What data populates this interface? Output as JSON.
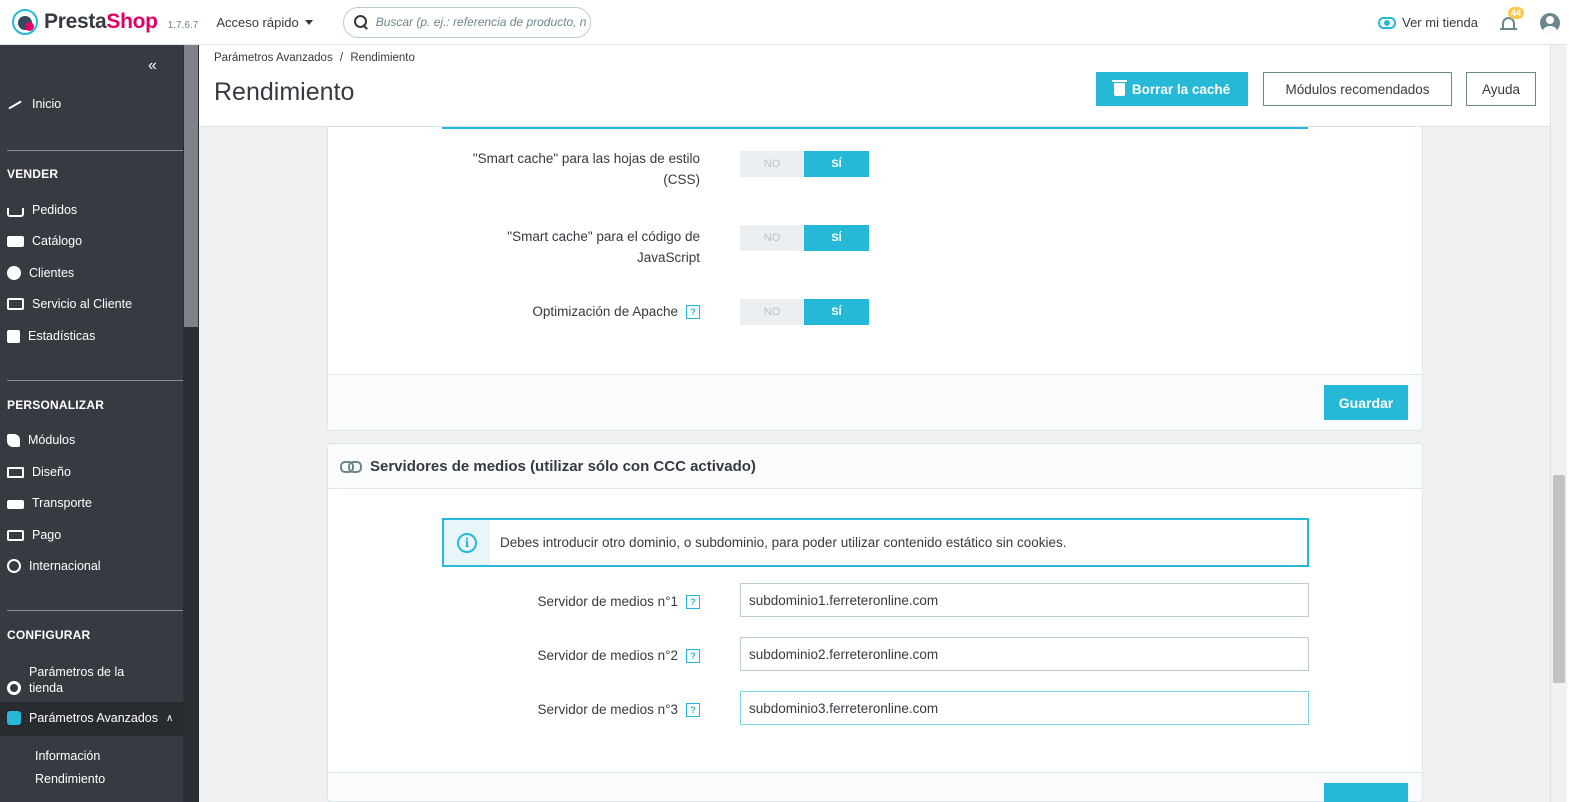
{
  "header": {
    "brand_presta": "Presta",
    "brand_shop": "Shop",
    "version": "1.7.6.7",
    "quick_access": "Acceso rápido",
    "search_placeholder": "Buscar (p. ej.: referencia de producto, nombre de cliente...)",
    "view_store": "Ver mi tienda",
    "notifications_count": "44"
  },
  "sidebar": {
    "collapse_glyph": "«",
    "home": "Inicio",
    "sections": [
      {
        "title": "VENDER",
        "items": [
          "Pedidos",
          "Catálogo",
          "Clientes",
          "Servicio al Cliente",
          "Estadísticas"
        ]
      },
      {
        "title": "PERSONALIZAR",
        "items": [
          "Módulos",
          "Diseño",
          "Transporte",
          "Pago",
          "Internacional"
        ]
      },
      {
        "title": "CONFIGURAR",
        "items": [
          "Parámetros de la tienda",
          "Parámetros Avanzados"
        ]
      }
    ],
    "subitems": [
      "Información",
      "Rendimiento"
    ],
    "active_item": "Parámetros Avanzados",
    "active_subitem": "Rendimiento"
  },
  "page": {
    "breadcrumb_parent": "Parámetros Avanzados",
    "breadcrumb_sep": "/",
    "breadcrumb_current": "Rendimiento",
    "title": "Rendimiento",
    "btn_clear_cache": "Borrar la caché",
    "btn_recommended": "Módulos recomendados",
    "btn_help": "Ayuda"
  },
  "ccc_panel": {
    "rows": [
      {
        "label": "\"Smart cache\" para las hojas de estilo (CSS)",
        "no": "NO",
        "yes": "SÍ",
        "value": "SÍ"
      },
      {
        "label": "\"Smart cache\" para el código de JavaScript",
        "no": "NO",
        "yes": "SÍ",
        "value": "SÍ"
      },
      {
        "label": "Optimización de Apache",
        "no": "NO",
        "yes": "SÍ",
        "value": "SÍ",
        "help": "?"
      }
    ],
    "save": "Guardar"
  },
  "media_panel": {
    "title": "Servidores de medios (utilizar sólo con CCC activado)",
    "alert": "Debes introducir otro dominio, o subdominio, para poder utilizar contenido estático sin cookies.",
    "info_glyph": "i",
    "servers": [
      {
        "label": "Servidor de medios n°1",
        "value": "subdominio1.ferreteronline.com",
        "help": "?"
      },
      {
        "label": "Servidor de medios n°2",
        "value": "subdominio2.ferreteronline.com",
        "help": "?"
      },
      {
        "label": "Servidor de medios n°3",
        "value": "subdominio3.ferreteronline.com",
        "help": "?"
      }
    ]
  },
  "colors": {
    "accent": "#25b9d7",
    "sidebar": "#363a41",
    "brand_pink": "#df0067"
  }
}
